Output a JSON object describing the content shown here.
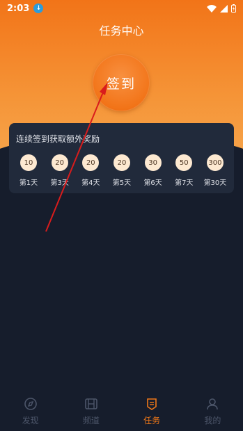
{
  "status_bar": {
    "time": "2:03"
  },
  "header": {
    "title": "任务中心"
  },
  "signin": {
    "label": "签到"
  },
  "reward_card": {
    "title": "连续签到获取额外奖励",
    "days": [
      {
        "amount": "10",
        "label": "第1天"
      },
      {
        "amount": "20",
        "label": "第3天"
      },
      {
        "amount": "20",
        "label": "第4天"
      },
      {
        "amount": "20",
        "label": "第5天"
      },
      {
        "amount": "30",
        "label": "第6天"
      },
      {
        "amount": "50",
        "label": "第7天"
      },
      {
        "amount": "300",
        "label": "第30天"
      }
    ]
  },
  "tabbar": {
    "items": [
      {
        "label": "发现",
        "icon": "compass-icon",
        "active": false
      },
      {
        "label": "频道",
        "icon": "film-icon",
        "active": false
      },
      {
        "label": "任务",
        "icon": "task-icon",
        "active": true
      },
      {
        "label": "我的",
        "icon": "person-icon",
        "active": false
      }
    ]
  },
  "colors": {
    "accent": "#f07818",
    "background": "#161d2c",
    "card": "#212a3b",
    "coin": "#fde9d1"
  }
}
